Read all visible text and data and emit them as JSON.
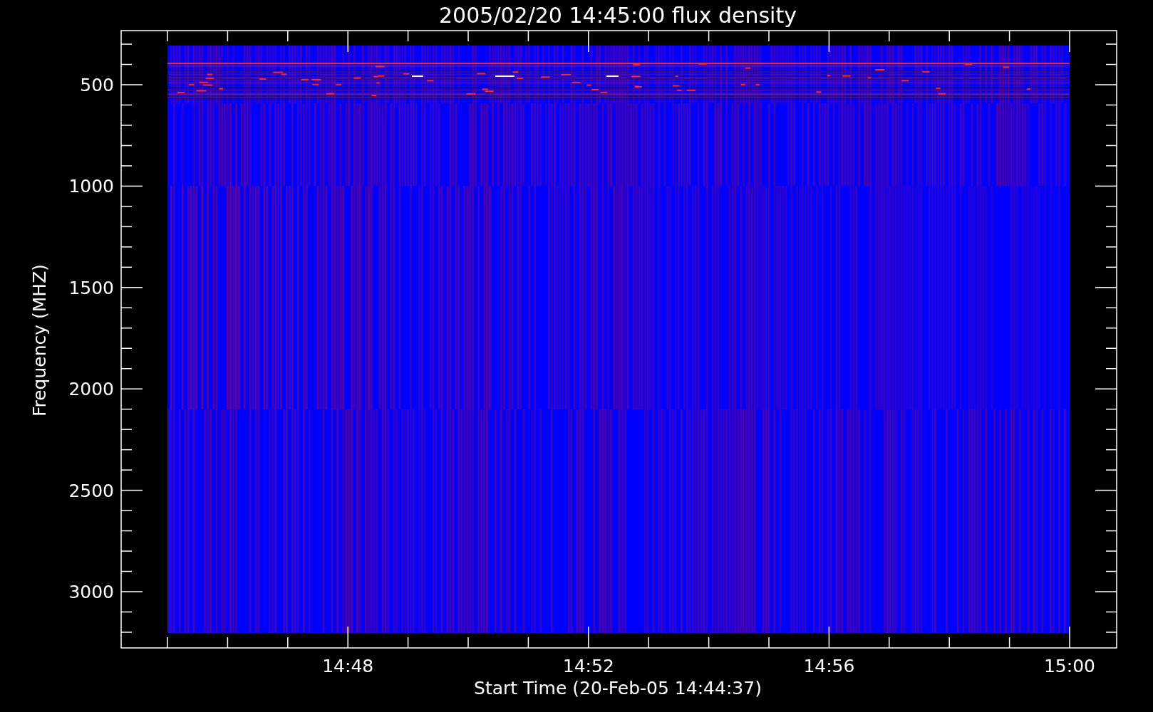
{
  "plot": {
    "title": "2005/02/20 14:45:00 flux density",
    "ylabel": "Frequency (MHZ)",
    "xlabel": "Start Time (20-Feb-05 14:44:37)",
    "yticks": [
      "500",
      "1000",
      "1500",
      "2000",
      "2500",
      "3000"
    ],
    "xticks": [
      "14:48",
      "14:52",
      "14:56",
      "15:00"
    ]
  }
}
